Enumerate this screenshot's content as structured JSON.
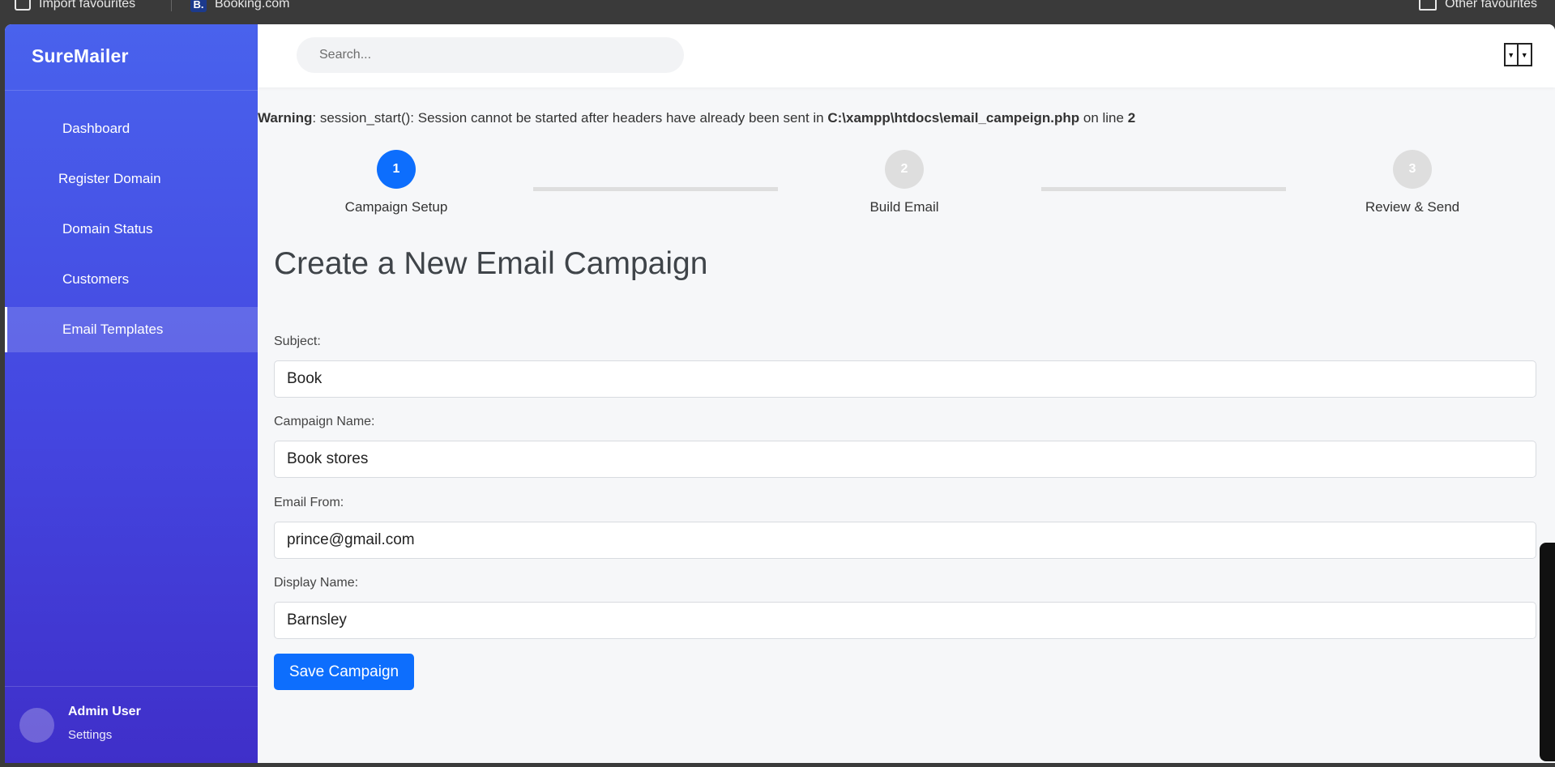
{
  "favbar": {
    "import_label": "Import favourites",
    "booking_label": "Booking.com",
    "booking_icon_letter": "B.",
    "other_label": "Other favourites"
  },
  "sidebar": {
    "brand": "SureMailer",
    "items": [
      {
        "label": "Dashboard",
        "active": false
      },
      {
        "label": "Register Domain",
        "active": false
      },
      {
        "label": "Domain Status",
        "active": false
      },
      {
        "label": "Customers",
        "active": false
      },
      {
        "label": "Email Templates",
        "active": true
      }
    ],
    "user": {
      "name": "Admin User",
      "settings_label": "Settings"
    }
  },
  "header": {
    "search_placeholder": "Search..."
  },
  "warning": {
    "prefix": "Warning",
    "message": ": session_start(): Session cannot be started after headers have already been sent in ",
    "file": "C:\\xampp\\htdocs\\email_campeign.php",
    "line_text": " on line ",
    "line_number": "2"
  },
  "steps": [
    {
      "number": "1",
      "label": "Campaign Setup",
      "active": true
    },
    {
      "number": "2",
      "label": "Build Email",
      "active": false
    },
    {
      "number": "3",
      "label": "Review & Send",
      "active": false
    }
  ],
  "form": {
    "title": "Create a New Email Campaign",
    "fields": [
      {
        "label": "Subject:",
        "value": "Book"
      },
      {
        "label": "Campaign Name:",
        "value": "Book stores"
      },
      {
        "label": "Email From:",
        "value": "prince@gmail.com"
      },
      {
        "label": "Display Name:",
        "value": "Barnsley"
      }
    ],
    "save_label": "Save Campaign"
  },
  "colors": {
    "primary": "#0d6efd",
    "sidebar_top": "#4962ed",
    "sidebar_bottom": "#3f2fc9",
    "step_inactive": "#dedede"
  }
}
